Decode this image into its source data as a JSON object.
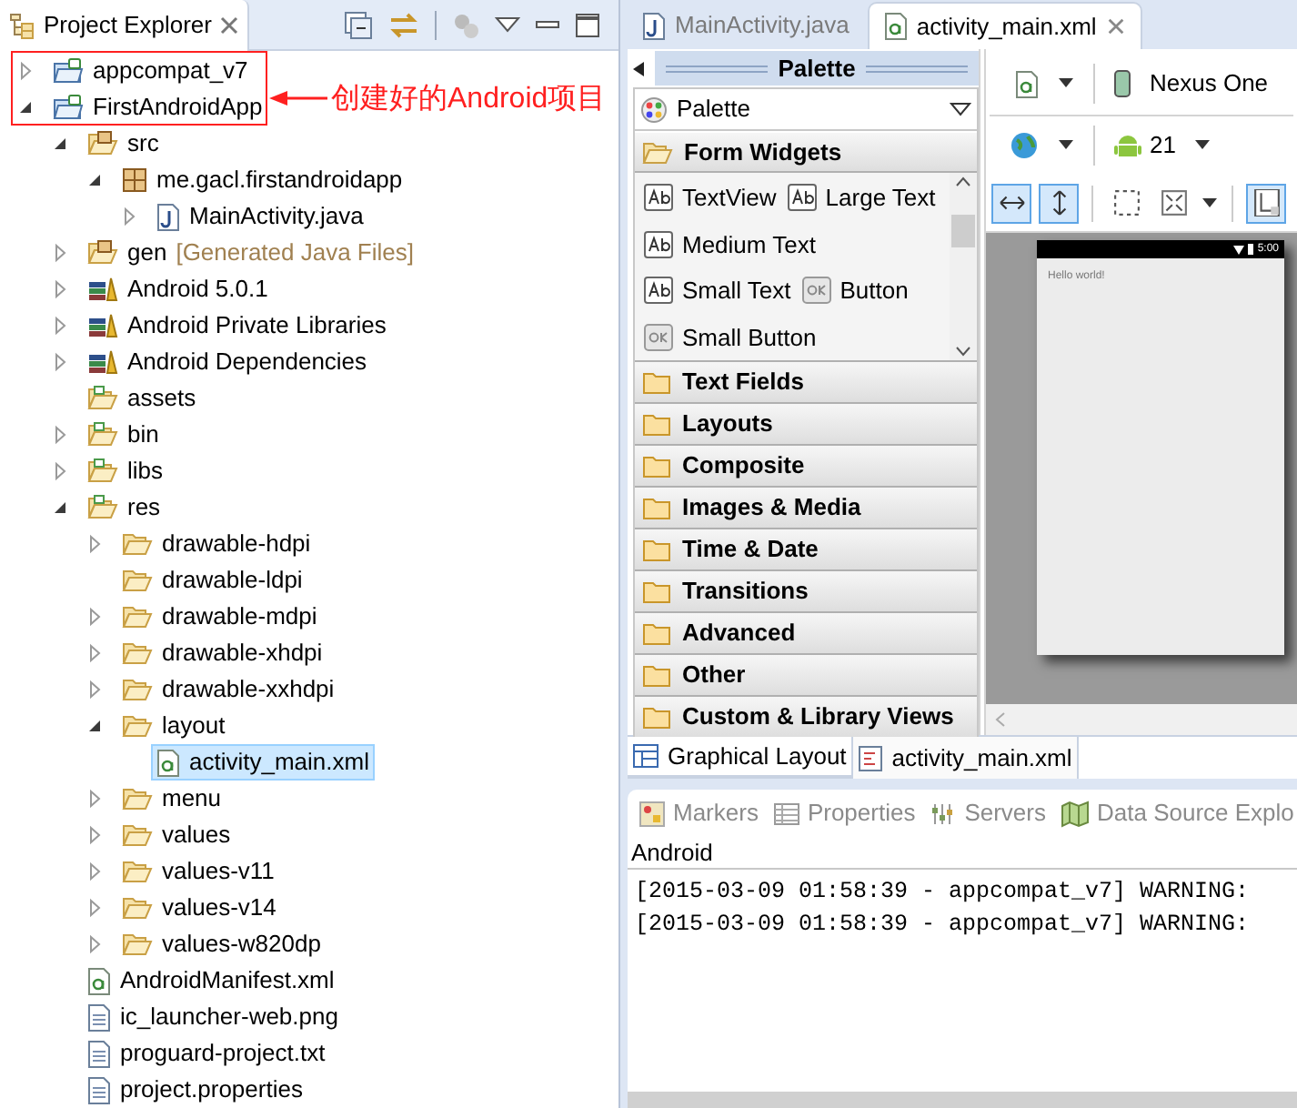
{
  "project_explorer": {
    "title": "Project Explorer",
    "tree": [
      {
        "label": "appcompat_v7",
        "kind": "project",
        "expanded": false,
        "selected": false
      },
      {
        "label": "FirstAndroidApp",
        "kind": "project",
        "expanded": true,
        "selected": false,
        "children": [
          {
            "label": "src",
            "kind": "source-folder",
            "expanded": true,
            "selected": false,
            "children": [
              {
                "label": "me.gacl.firstandroidapp",
                "kind": "package",
                "expanded": true,
                "selected": false,
                "children": [
                  {
                    "label": "MainActivity.java",
                    "kind": "java",
                    "expanded": false,
                    "selected": false
                  }
                ]
              }
            ]
          },
          {
            "label": "gen",
            "decoration": "[Generated Java Files]",
            "kind": "source-folder",
            "expanded": false,
            "selected": false
          },
          {
            "label": "Android 5.0.1",
            "kind": "library",
            "expanded": false,
            "selected": false
          },
          {
            "label": "Android Private Libraries",
            "kind": "library",
            "expanded": false,
            "selected": false
          },
          {
            "label": "Android Dependencies",
            "kind": "library",
            "expanded": false,
            "selected": false
          },
          {
            "label": "assets",
            "kind": "res-folder",
            "selected": false
          },
          {
            "label": "bin",
            "kind": "res-folder",
            "expanded": false,
            "selected": false
          },
          {
            "label": "libs",
            "kind": "res-folder",
            "expanded": false,
            "selected": false
          },
          {
            "label": "res",
            "kind": "res-folder",
            "expanded": true,
            "selected": false,
            "children": [
              {
                "label": "drawable-hdpi",
                "kind": "folder",
                "expanded": false,
                "selected": false
              },
              {
                "label": "drawable-ldpi",
                "kind": "folder",
                "selected": false
              },
              {
                "label": "drawable-mdpi",
                "kind": "folder",
                "expanded": false,
                "selected": false
              },
              {
                "label": "drawable-xhdpi",
                "kind": "folder",
                "expanded": false,
                "selected": false
              },
              {
                "label": "drawable-xxhdpi",
                "kind": "folder",
                "expanded": false,
                "selected": false
              },
              {
                "label": "layout",
                "kind": "folder",
                "expanded": true,
                "selected": false,
                "children": [
                  {
                    "label": "activity_main.xml",
                    "kind": "xml",
                    "selected": true
                  }
                ]
              },
              {
                "label": "menu",
                "kind": "folder",
                "expanded": false,
                "selected": false
              },
              {
                "label": "values",
                "kind": "folder",
                "expanded": false,
                "selected": false
              },
              {
                "label": "values-v11",
                "kind": "folder",
                "expanded": false,
                "selected": false
              },
              {
                "label": "values-v14",
                "kind": "folder",
                "expanded": false,
                "selected": false
              },
              {
                "label": "values-w820dp",
                "kind": "folder",
                "expanded": false,
                "selected": false
              }
            ]
          },
          {
            "label": "AndroidManifest.xml",
            "kind": "xml",
            "selected": false
          },
          {
            "label": "ic_launcher-web.png",
            "kind": "file",
            "selected": false
          },
          {
            "label": "proguard-project.txt",
            "kind": "file",
            "selected": false
          },
          {
            "label": "project.properties",
            "kind": "file",
            "selected": false
          }
        ]
      }
    ]
  },
  "annotation": {
    "text": "创建好的Android项目"
  },
  "editor": {
    "tabs": [
      {
        "label": "MainActivity.java",
        "kind": "java",
        "selected": false
      },
      {
        "label": "activity_main.xml",
        "kind": "xml",
        "selected": true
      }
    ],
    "palette": {
      "title": "Palette",
      "dropdown": "Palette",
      "sections": [
        {
          "label": "Form Widgets",
          "expanded": true,
          "widget_rows": [
            [
              {
                "label": "TextView",
                "kind": "text"
              },
              {
                "label": "Large Text",
                "kind": "text"
              }
            ],
            [
              {
                "label": "Medium Text",
                "kind": "text"
              }
            ],
            [
              {
                "label": "Small Text",
                "kind": "text"
              },
              {
                "label": "Button",
                "kind": "button"
              }
            ],
            [
              {
                "label": "Small Button",
                "kind": "button"
              }
            ]
          ]
        },
        {
          "label": "Text Fields",
          "expanded": false
        },
        {
          "label": "Layouts",
          "expanded": false
        },
        {
          "label": "Composite",
          "expanded": false
        },
        {
          "label": "Images & Media",
          "expanded": false
        },
        {
          "label": "Time & Date",
          "expanded": false
        },
        {
          "label": "Transitions",
          "expanded": false
        },
        {
          "label": "Advanced",
          "expanded": false
        },
        {
          "label": "Other",
          "expanded": false
        },
        {
          "label": "Custom & Library Views",
          "expanded": false
        }
      ]
    },
    "toolbar": {
      "device": "Nexus One",
      "api": "21",
      "view_buttons": [
        {
          "kind": "fit-width",
          "selected": true
        },
        {
          "kind": "fit-height",
          "selected": true
        },
        {
          "kind": "margins",
          "selected": false
        },
        {
          "kind": "zoom",
          "selected": false
        },
        {
          "kind": "layout",
          "selected": true
        }
      ]
    },
    "preview": {
      "clock": "5:00",
      "text": "Hello world!"
    },
    "bottom_tabs": [
      {
        "label": "Graphical Layout",
        "kind": "layout",
        "selected": true
      },
      {
        "label": "activity_main.xml",
        "kind": "xml",
        "selected": false
      }
    ]
  },
  "console": {
    "tabs": [
      {
        "label": "Markers",
        "kind": "markers"
      },
      {
        "label": "Properties",
        "kind": "properties"
      },
      {
        "label": "Servers",
        "kind": "servers"
      },
      {
        "label": "Data Source Explo",
        "kind": "datasource"
      }
    ],
    "title": "Android",
    "lines": [
      "[2015-03-09 01:58:39 - appcompat_v7] WARNING:",
      "[2015-03-09 01:58:39 - appcompat_v7] WARNING:"
    ]
  }
}
